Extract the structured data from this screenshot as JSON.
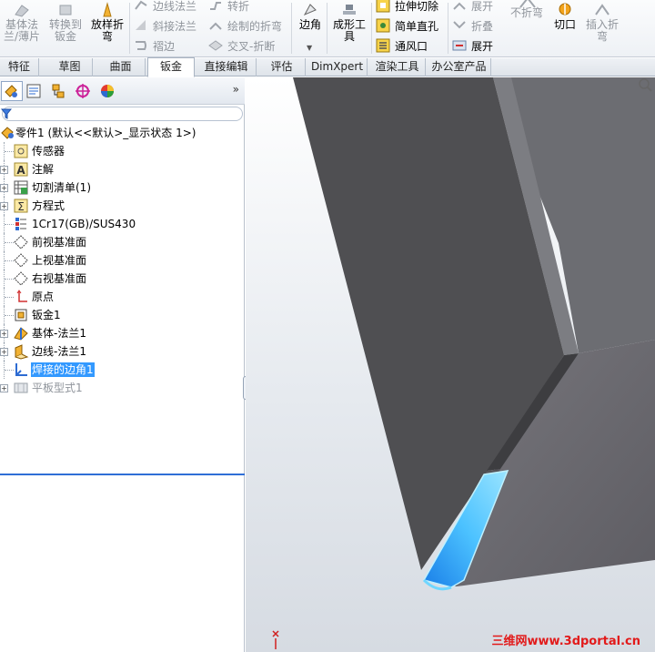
{
  "ribbon": {
    "big_buttons": [
      {
        "label": "基体法\n兰/薄片",
        "icon": "base-flange-icon",
        "enabled": false
      },
      {
        "label": "转换到\n钣金",
        "icon": "convert-to-sheetmetal-icon",
        "enabled": false
      },
      {
        "label": "放样折\n弯",
        "icon": "lofted-bend-icon",
        "enabled": true
      },
      {
        "label": "边角",
        "icon": "corners-icon",
        "enabled": true
      },
      {
        "label": "成形工\n具",
        "icon": "forming-tool-icon",
        "enabled": true
      },
      {
        "label": "不折弯",
        "icon": "no-bends-icon",
        "enabled": false
      },
      {
        "label": "切口",
        "icon": "rip-icon",
        "enabled": true
      },
      {
        "label": "插入折\n弯",
        "icon": "insert-bends-icon",
        "enabled": false
      }
    ],
    "small_buttons": {
      "edge_flange": "边线法兰",
      "miter_flange": "斜接法兰",
      "hem": "褶边",
      "jog": "转折",
      "sketched_bend": "绘制的折弯",
      "cross_break": "交叉-折断",
      "extruded_cut": "拉伸切除",
      "simple_hole": "简单直孔",
      "vent": "通风口",
      "unfold": "展开",
      "fold": "折叠",
      "flatten": "展开"
    }
  },
  "tabs": [
    {
      "label": "特征",
      "active": false
    },
    {
      "label": "草图",
      "active": false
    },
    {
      "label": "曲面",
      "active": false
    },
    {
      "label": "钣金",
      "active": true
    },
    {
      "label": "直接编辑",
      "active": false
    },
    {
      "label": "评估",
      "active": false
    },
    {
      "label": "DimXpert",
      "active": false
    },
    {
      "label": "渲染工具",
      "active": false
    },
    {
      "label": "办公室产品",
      "active": false
    }
  ],
  "panel": {
    "tabs": [
      "feature-manager-icon",
      "property-manager-icon",
      "configuration-manager-icon",
      "dimxpert-manager-icon",
      "display-manager-icon"
    ],
    "more": "»"
  },
  "tree": {
    "root": "零件1 (默认<<默认>_显示状态 1>)",
    "items": [
      {
        "label": "传感器",
        "icon": "sensor-icon",
        "expander": false
      },
      {
        "label": "注解",
        "icon": "annotations-icon",
        "expander": true
      },
      {
        "label": "切割清单(1)",
        "icon": "cut-list-icon",
        "expander": true
      },
      {
        "label": "方程式",
        "icon": "equations-icon",
        "expander": true
      },
      {
        "label": "1Cr17(GB)/SUS430",
        "icon": "material-icon",
        "expander": false
      },
      {
        "label": "前视基准面",
        "icon": "plane-icon",
        "expander": false
      },
      {
        "label": "上视基准面",
        "icon": "plane-icon",
        "expander": false
      },
      {
        "label": "右视基准面",
        "icon": "plane-icon",
        "expander": false
      },
      {
        "label": "原点",
        "icon": "origin-icon",
        "expander": false
      },
      {
        "label": "钣金1",
        "icon": "sheet-metal-icon",
        "expander": false
      },
      {
        "label": "基体-法兰1",
        "icon": "base-flange-feature-icon",
        "expander": true
      },
      {
        "label": "边线-法兰1",
        "icon": "edge-flange-feature-icon",
        "expander": true
      },
      {
        "label": "焊接的边角1",
        "icon": "welded-corner-icon",
        "expander": false,
        "selected": true
      },
      {
        "label": "平板型式1",
        "icon": "flat-pattern-icon",
        "expander": true,
        "suppressed": true
      }
    ]
  },
  "viewport": {
    "watermark": "三维网www.3dportal.cn",
    "colors": {
      "face_dark": "#4f4f52",
      "face_right": "#6d6c72",
      "highlight": "#2ea8ff"
    }
  }
}
